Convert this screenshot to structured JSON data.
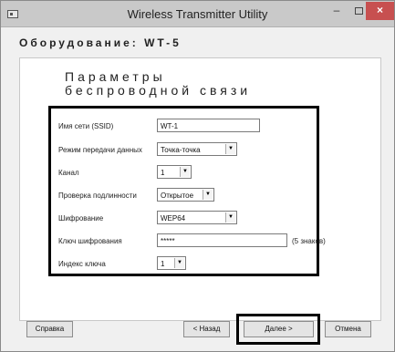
{
  "window": {
    "title": "Wireless Transmitter Utility",
    "minimize": "–",
    "close": "×"
  },
  "equipment": {
    "label": "Оборудование: WT-5"
  },
  "page": {
    "heading": "Параметры\nбеспроводной связи"
  },
  "form": {
    "ssid": {
      "label": "Имя сети (SSID)",
      "value": "WT-1"
    },
    "mode": {
      "label": "Режим передачи данных",
      "value": "Точка-точка"
    },
    "channel": {
      "label": "Канал",
      "value": "1"
    },
    "auth": {
      "label": "Проверка подлинности",
      "value": "Открытое"
    },
    "encryption": {
      "label": "Шифрование",
      "value": "WEP64"
    },
    "key": {
      "label": "Ключ шифрования",
      "value": "*****",
      "hint": "(5 знаков)"
    },
    "key_index": {
      "label": "Индекс ключа",
      "value": "1"
    }
  },
  "buttons": {
    "help": "Справка",
    "back": "< Назад",
    "next": "Далее >",
    "cancel": "Отмена"
  },
  "icons": {
    "dropdown_arrow": "▼"
  }
}
